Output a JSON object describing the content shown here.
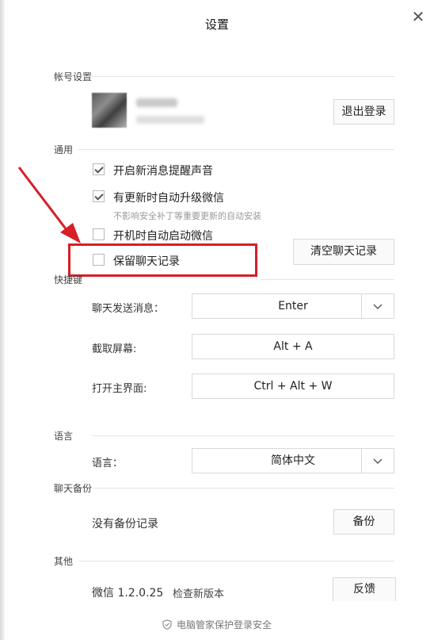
{
  "window": {
    "title": "设置",
    "close_glyph": "✕"
  },
  "account": {
    "section_label": "帐号设置",
    "logout_label": "退出登录"
  },
  "general": {
    "section_label": "通用",
    "options": [
      {
        "label": "开启新消息提醒声音",
        "checked": true
      },
      {
        "label": "有更新时自动升级微信",
        "checked": true,
        "hint": "不影响安全补丁等重要更新的自动安装"
      },
      {
        "label": "开机时自动启动微信",
        "checked": false
      },
      {
        "label": "保留聊天记录",
        "checked": false
      }
    ],
    "clear_history_label": "清空聊天记录",
    "highlight_color": "#d61f26"
  },
  "shortcuts": {
    "section_label": "快捷键",
    "items": [
      {
        "label": "聊天发送消息：",
        "value": "Enter",
        "has_dropdown": true
      },
      {
        "label": "截取屏幕:",
        "value": "Alt + A",
        "has_dropdown": false
      },
      {
        "label": "打开主界面:",
        "value": "Ctrl + Alt + W",
        "has_dropdown": false
      }
    ]
  },
  "language": {
    "section_label": "语言",
    "label": "语言：",
    "value": "简体中文"
  },
  "backup": {
    "section_label": "聊天备份",
    "status": "没有备份记录",
    "button_label": "备份"
  },
  "other": {
    "section_label": "其他",
    "version": "微信 1.2.0.25",
    "check_update": "检查新版本",
    "feedback_label": "反馈"
  },
  "footer": {
    "text": "电脑管家保护登录安全",
    "icon": "shield-icon"
  }
}
